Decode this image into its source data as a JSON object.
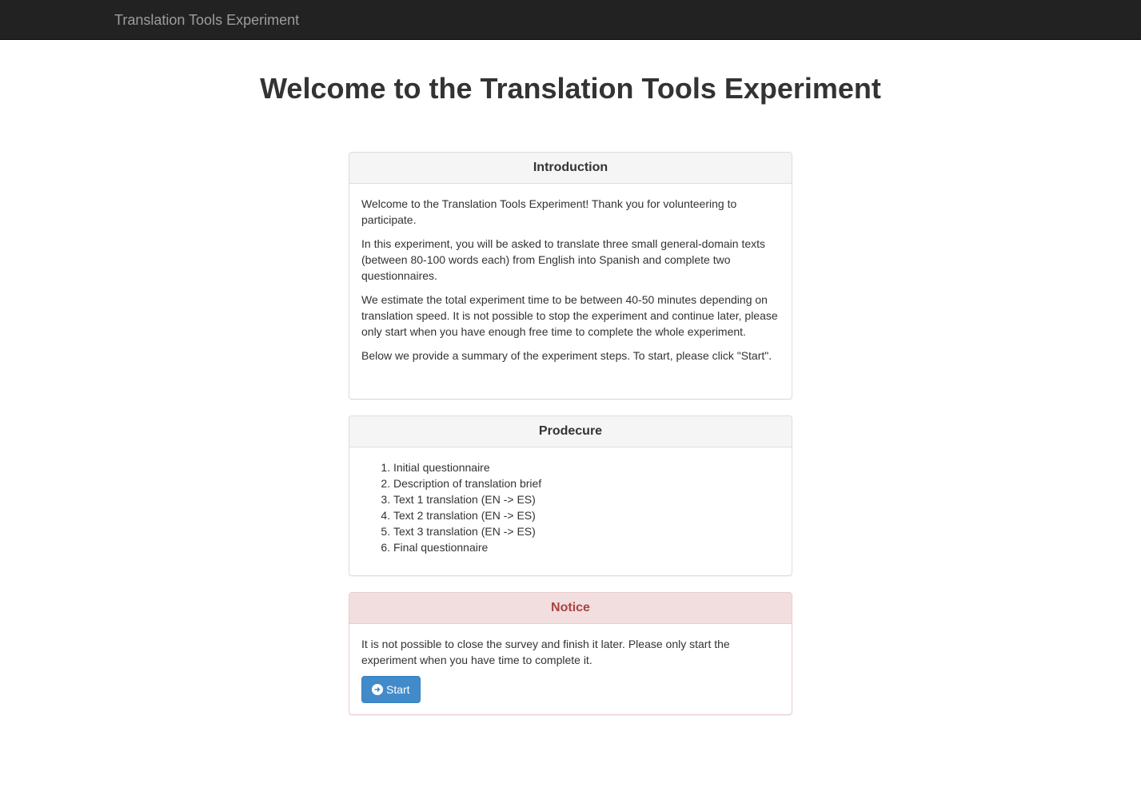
{
  "navbar": {
    "brand": "Translation Tools Experiment"
  },
  "page": {
    "title": "Welcome to the Translation Tools Experiment"
  },
  "introduction": {
    "heading": "Introduction",
    "paragraphs": [
      "Welcome to the Translation Tools Experiment! Thank you for volunteering to participate.",
      "In this experiment, you will be asked to translate three small general-domain texts (between 80-100 words each) from English into Spanish and complete two questionnaires.",
      "We estimate the total experiment time to be between 40-50 minutes depending on translation speed. It is not possible to stop the experiment and continue later, please only start when you have enough free time to complete the whole experiment.",
      "Below we provide a summary of the experiment steps. To start, please click \"Start\"."
    ]
  },
  "procedure": {
    "heading": "Prodecure",
    "steps": [
      "Initial questionnaire",
      "Description of translation brief",
      "Text 1 translation (EN -> ES)",
      "Text 2 translation (EN -> ES)",
      "Text 3 translation (EN -> ES)",
      "Final questionnaire"
    ]
  },
  "notice": {
    "heading": "Notice",
    "text": "It is not possible to close the survey and finish it later. Please only start the experiment when you have time to complete it.",
    "start_label": "Start",
    "start_icon": "arrow-circle-right-icon"
  },
  "colors": {
    "navbar_bg": "#222222",
    "brand_text": "#9d9d9d",
    "notice_heading_bg": "#f2dede",
    "notice_heading_text": "#a94442",
    "primary_button": "#428bca"
  }
}
